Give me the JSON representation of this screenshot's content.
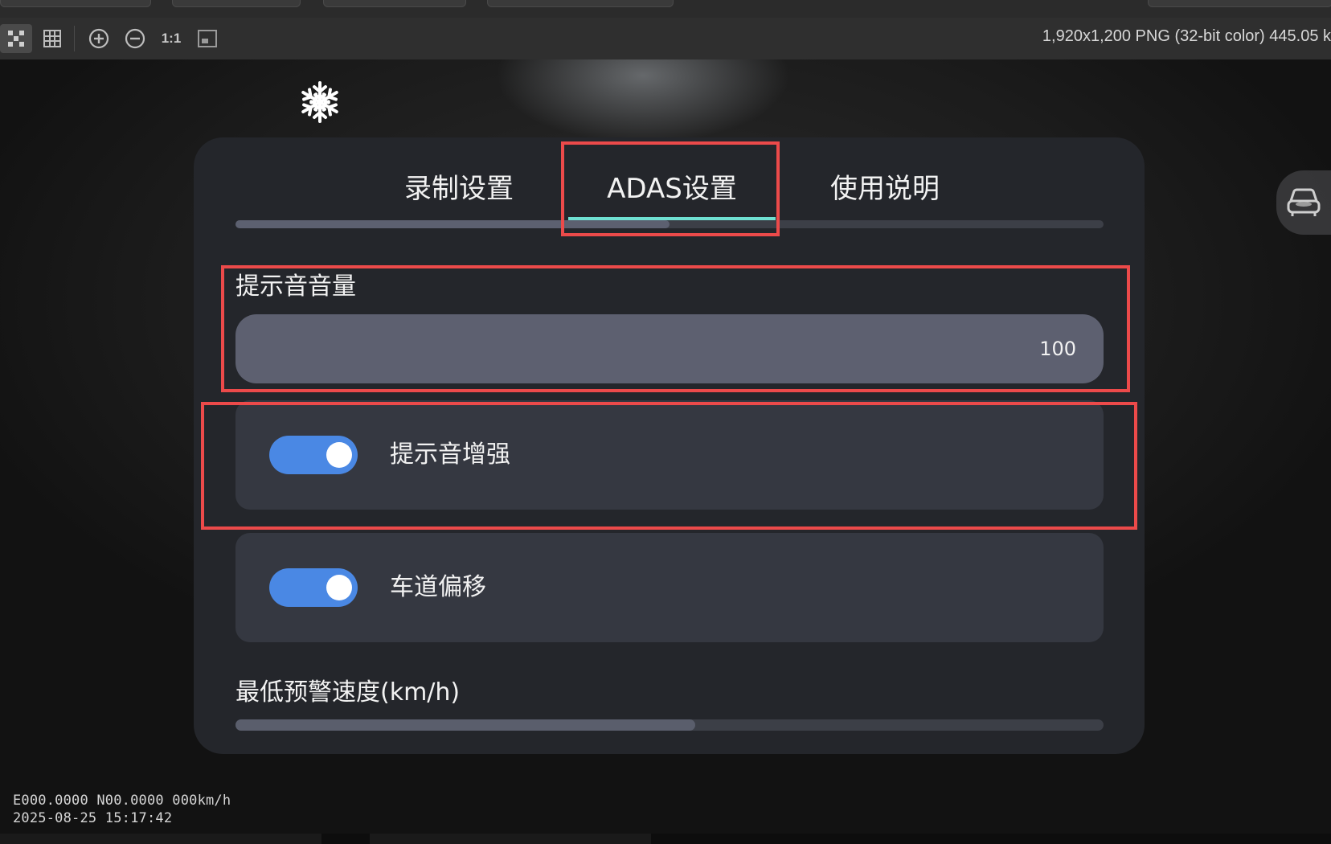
{
  "viewer": {
    "image_info": "1,920x1,200 PNG (32-bit color) 445.05 k",
    "tools": [
      {
        "name": "fit-icon"
      },
      {
        "name": "grid-icon"
      },
      {
        "name": "zoom-in-icon"
      },
      {
        "name": "zoom-out-icon"
      },
      {
        "name": "actual-size-icon",
        "label": "1:1"
      },
      {
        "name": "fullscreen-icon"
      }
    ]
  },
  "settings": {
    "tabs": [
      {
        "label": "录制设置",
        "selected": false
      },
      {
        "label": "ADAS设置",
        "selected": true
      },
      {
        "label": "使用说明",
        "selected": false
      }
    ],
    "volume": {
      "label": "提示音音量",
      "value": "100"
    },
    "toggles": [
      {
        "label": "提示音增强",
        "on": true
      },
      {
        "label": "车道偏移",
        "on": true
      }
    ],
    "min_speed": {
      "label": "最低预警速度(km/h)",
      "fill_fraction": 0.53
    }
  },
  "overlay": {
    "gps": "E000.0000 N00.0000 000km/h",
    "datetime": "2025-08-25 15:17:42"
  },
  "colors": {
    "accent": "#4a88e4",
    "tab_indicator": "#6fe0d2",
    "annotation": "#ec4a4a",
    "panel": "#24262b"
  }
}
